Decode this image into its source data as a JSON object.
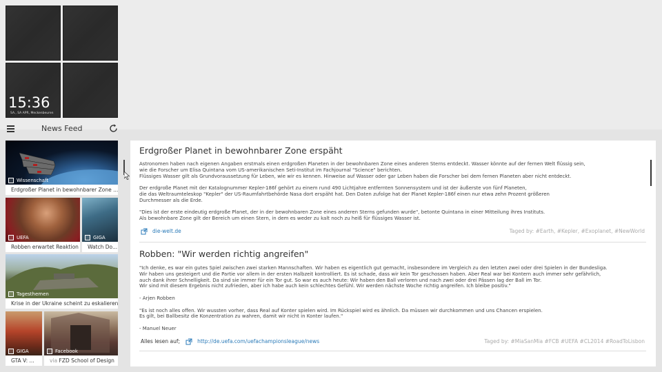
{
  "clock": {
    "time": "15:36",
    "date": "SA., SA APR, Meckenbeuren"
  },
  "feed": {
    "title": "News Feed"
  },
  "thumbnails": [
    {
      "caption": "Erdgroßer Planet in bewohnbarer Zone ...",
      "tag": "Wissenschaft"
    },
    {
      "caption": "Robben erwartet Reaktion",
      "tag": "UEFA"
    },
    {
      "caption": "Watch Do...",
      "tag": "GIGA"
    },
    {
      "caption": "Krise in der Ukraine scheint zu eskalieren",
      "tag": "Tagesthemen"
    },
    {
      "caption": "GTA V: ...",
      "tag": "GIGA"
    },
    {
      "caption_prefix": "via",
      "caption": "FZD School of Design",
      "tag": "Facebook"
    }
  ],
  "articles": [
    {
      "title": "Erdgroßer Planet in bewohnbarer Zone erspäht",
      "paragraphs": [
        "Astronomen haben nach eigenen Angaben erstmals einen erdgroßen Planeten in der bewohnbaren Zone eines anderen Sterns entdeckt. Wasser könnte auf der fernen Welt flüssig sein,\nwie die Forscher um Elisa Quintana vom US-amerikanischen Seti-Institut im Fachjournal \"Science\" berichten.\nFlüssiges Wasser gilt als Grundvoraussetzung für Leben, wie wir es kennen. Hinweise auf Wasser oder gar Leben haben die Forscher bei dem fernen Planeten aber nicht entdeckt.",
        "Der erdgroße Planet mit der Katalognummer Kepler-186f gehört zu einem rund 490 Lichtjahre entfernten Sonnensystem und ist der äußerste von fünf Planeten,\ndie das Weltraumteleskop \"Kepler\" der US-Raumfahrtbehörde Nasa dort erspäht hat. Den Daten zufolge hat der Planet Kepler-186f einen nur etwa zehn Prozent größeren\nDurchmesser als die Erde.",
        "\"Dies ist der erste eindeutig erdgroße Planet, der in der bewohnbaren Zone eines anderen Sterns gefunden wurde\", betonte Quintana in einer Mitteilung ihres Instituts.\nAls bewohnbare Zone gilt der Bereich um einen Stern, in dem es weder zu kalt noch zu heiß für flüssiges Wasser ist."
      ],
      "read_all": "",
      "link": "die-welt.de",
      "tags_label": "Taged by:",
      "tags": "#Earth, #Kepler, #Exoplanet, #NewWorld"
    },
    {
      "title": "Robben: \"Wir werden richtig angreifen\"",
      "paragraphs": [
        "\"Ich denke, es war ein gutes Spiel zwischen zwei starken Mannschaften. Wir haben es eigentlich gut gemacht, insbesondere im Vergleich zu den letzten zwei oder drei Spielen in der Bundesliga.\nWir haben uns gesteigert und die Partie vor allem in der ersten Halbzeit kontrolliert. Es ist schade, dass wir kein Tor geschossen haben. Aber Real war bei Kontern auch immer sehr gefährlich,\nauch dank ihrer Schnelligkeit. Da sind sie immer für ein Tor gut. So war es auch heute: Wir haben den Ball verloren und nach zwei oder drei Pässen lag der Ball im Tor.\nWir sind mit diesem Ergebnis nicht zufrieden, aber ich habe auch kein schlechtes Gefühl. Wir werden nächste Woche richtig angreifen. Ich bleibe positiv.\"",
        "  - Arjen Robben",
        "\"Es ist noch alles offen. Wir wussten vorher, dass Real auf Konter spielen wird. Im Rückspiel wird es ähnlich. Da müssen wir durchkommen und uns Chancen erspielen.\nEs gilt, bei Ballbesitz die Konzentration zu wahren, damit wir nicht in Konter laufen.\"",
        "  - Manuel Neuer"
      ],
      "read_all": "Alles lesen auf;",
      "link": "http://de.uefa.com/uefachampionsleague/news",
      "tags_label": "Taged by:",
      "tags": "#MiaSanMia #FCB #UEFA #CL2014 #RoadToLisbon"
    }
  ]
}
